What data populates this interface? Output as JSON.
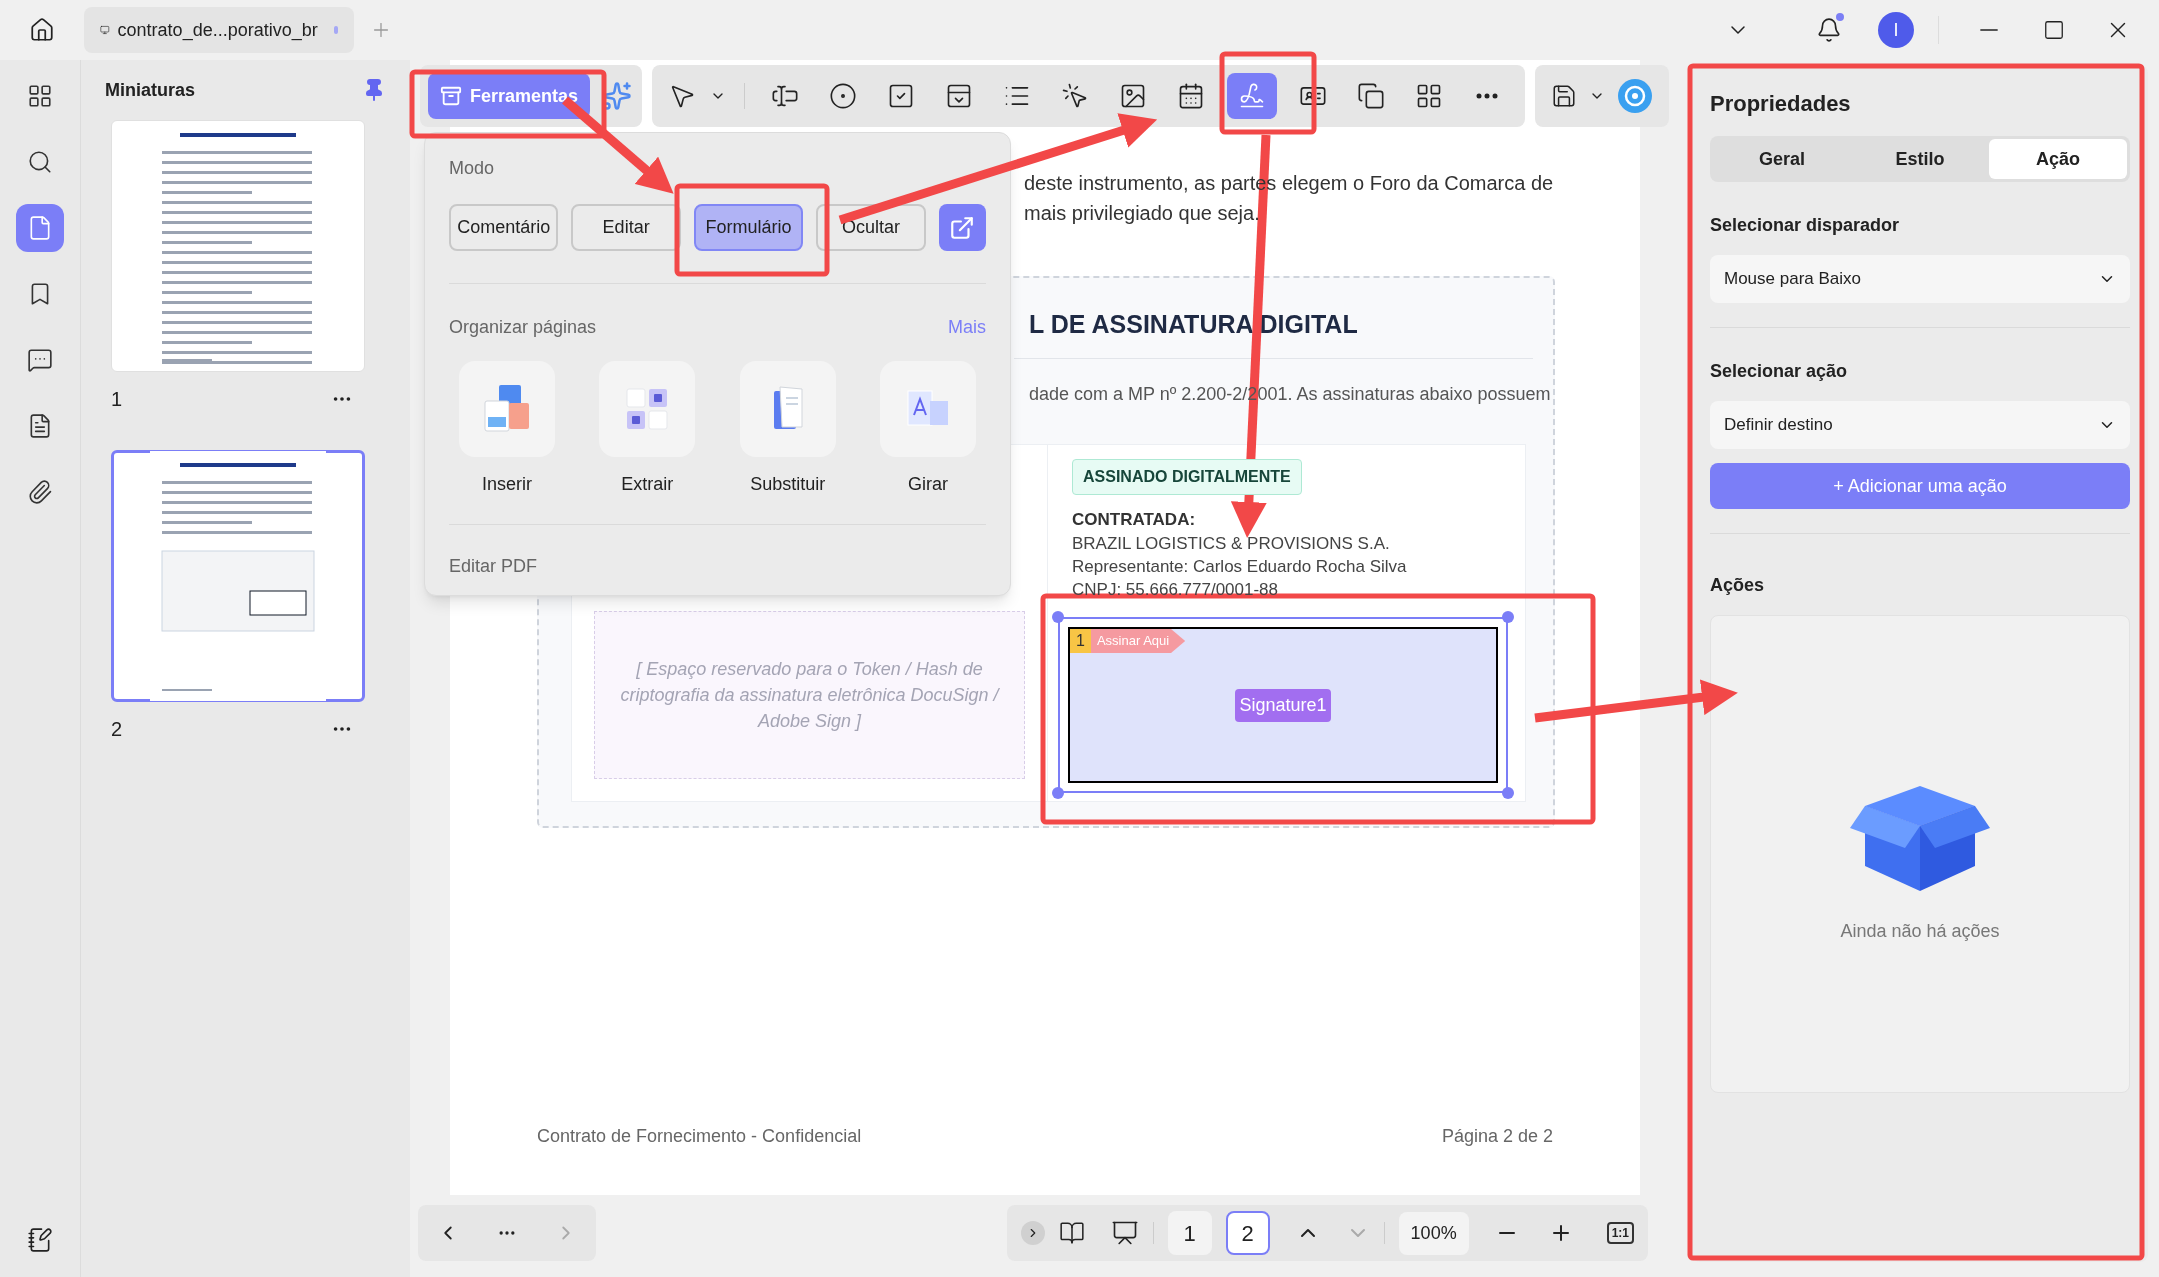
{
  "window": {
    "notification_dot": true,
    "avatar": "I"
  },
  "tab": {
    "title": "contrato_de...porativo_br",
    "unsaved": true
  },
  "rail": [
    {
      "kind": "grid",
      "selected": false
    },
    {
      "kind": "search",
      "selected": false
    },
    {
      "kind": "pages",
      "selected": true
    },
    {
      "kind": "bookmark",
      "selected": false
    },
    {
      "kind": "comment",
      "selected": false
    },
    {
      "kind": "form",
      "selected": false
    },
    {
      "kind": "attachment",
      "selected": false
    }
  ],
  "sidebar": {
    "title": "Miniaturas",
    "pinned": true
  },
  "thumbnails": [
    {
      "number": "1",
      "selected": false
    },
    {
      "number": "2",
      "selected": true
    }
  ],
  "toolbar": {
    "tools_label": "Ferramentas",
    "tools_selected": true,
    "tools": [
      {
        "kind": "pointer",
        "selected": false
      },
      {
        "kind": "text-field",
        "selected": false
      },
      {
        "kind": "radio",
        "selected": false
      },
      {
        "kind": "checkbox",
        "selected": false
      },
      {
        "kind": "combo",
        "selected": false
      },
      {
        "kind": "list",
        "selected": false
      },
      {
        "kind": "button",
        "selected": false
      },
      {
        "kind": "image",
        "selected": false
      },
      {
        "kind": "date",
        "selected": false
      },
      {
        "kind": "signature",
        "selected": true
      },
      {
        "kind": "digital-id",
        "selected": false
      },
      {
        "kind": "copy",
        "selected": false
      },
      {
        "kind": "grid",
        "selected": false
      },
      {
        "kind": "more",
        "selected": false
      }
    ]
  },
  "popup": {
    "mode_title": "Modo",
    "modes": [
      {
        "label": "Comentário",
        "selected": false
      },
      {
        "label": "Editar",
        "selected": false
      },
      {
        "label": "Formulário",
        "selected": true
      },
      {
        "label": "Ocultar",
        "selected": false
      }
    ],
    "organize_title": "Organizar páginas",
    "more": "Mais",
    "actions": [
      {
        "kind": "insert",
        "label": "Inserir"
      },
      {
        "kind": "extract",
        "label": "Extrair"
      },
      {
        "kind": "replace",
        "label": "Substituir"
      },
      {
        "kind": "rotate",
        "label": "Girar"
      }
    ],
    "edit_title": "Editar PDF"
  },
  "document": {
    "paragraph_lines": [
      "deste instrumento, as partes elegem o Foro da Comarca de",
      "mais privilegiado que seja."
    ],
    "portal_title": "L DE ASSINATURA DIGITAL",
    "portal_text": "dade com a MP nº 2.200-2/2001. As assinaturas abaixo possuem",
    "placeholder_note": "[ Espaço reservado para o Token / Hash de criptografia da assinatura eletrônica DocuSign / Adobe Sign ]",
    "badge": "ASSINADO DIGITALMENTE",
    "party_label": "CONTRATADA:",
    "party_lines": [
      "BRAZIL LOGISTICS & PROVISIONS S.A.",
      "Representante: Carlos Eduardo Rocha Silva",
      "CNPJ: 55.666.777/0001-88"
    ],
    "signature_field": {
      "order": "1",
      "hint": "Assinar Aqui",
      "name": "Signature1",
      "selected": true
    },
    "footer_left": "Contrato de Fornecimento - Confidencial",
    "footer_right": "Página 2 de 2"
  },
  "pager": {
    "pages": [
      {
        "label": "1",
        "selected": false
      },
      {
        "label": "2",
        "selected": true
      }
    ],
    "zoom": "100%",
    "fit": "1:1",
    "next_disabled": true
  },
  "properties": {
    "title": "Propriedades",
    "tabs": [
      {
        "label": "Geral",
        "selected": false
      },
      {
        "label": "Estilo",
        "selected": false
      },
      {
        "label": "Ação",
        "selected": true
      }
    ],
    "trigger_label": "Selecionar disparador",
    "trigger_value": "Mouse para Baixo",
    "action_label": "Selecionar ação",
    "action_value": "Definir destino",
    "add_button": "+ Adicionar uma ação",
    "actions_title": "Ações",
    "empty_text": "Ainda não há ações"
  }
}
